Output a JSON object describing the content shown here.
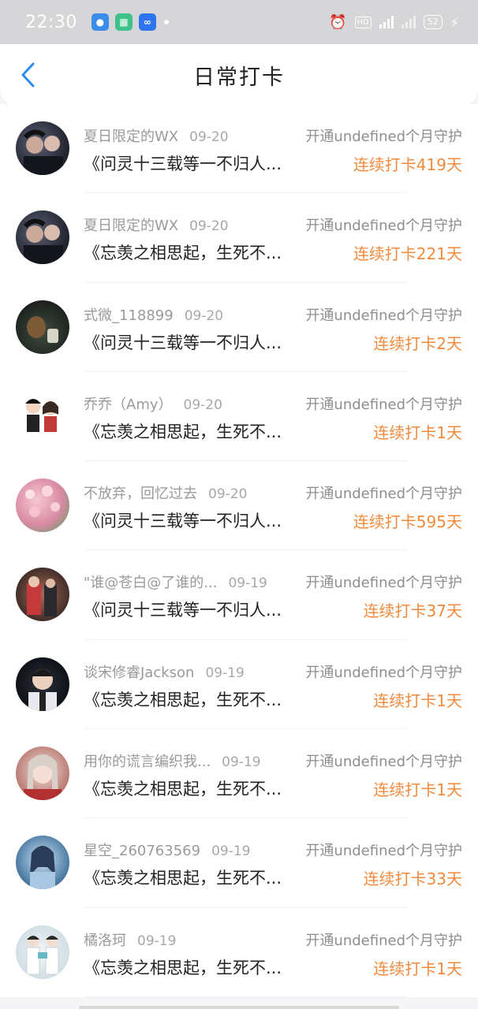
{
  "status_bar": {
    "time": "22:30",
    "battery": "52"
  },
  "header": {
    "title": "日常打卡"
  },
  "list": [
    {
      "name": "夏日限定的WX",
      "date": "09-20",
      "guard": "开通undefined个月守护",
      "content": "《问灵十三载等一不归人...",
      "streak": "连续打卡419天"
    },
    {
      "name": "夏日限定的WX",
      "date": "09-20",
      "guard": "开通undefined个月守护",
      "content": "《忘羡之相思起，生死不...",
      "streak": "连续打卡221天"
    },
    {
      "name": "式微_118899",
      "date": "09-20",
      "guard": "开通undefined个月守护",
      "content": "《问灵十三载等一不归人...",
      "streak": "连续打卡2天"
    },
    {
      "name": "乔乔（Amy）",
      "date": "09-20",
      "guard": "开通undefined个月守护",
      "content": "《忘羡之相思起，生死不...",
      "streak": "连续打卡1天"
    },
    {
      "name": "不放弃，回忆过去",
      "date": "09-20",
      "guard": "开通undefined个月守护",
      "content": "《问灵十三载等一不归人...",
      "streak": "连续打卡595天"
    },
    {
      "name": "\"谁@苍白@了谁的...",
      "date": "09-19",
      "guard": "开通undefined个月守护",
      "content": "《问灵十三载等一不归人...",
      "streak": "连续打卡37天"
    },
    {
      "name": "谈宋修睿Jackson",
      "date": "09-19",
      "guard": "开通undefined个月守护",
      "content": "《忘羡之相思起，生死不...",
      "streak": "连续打卡1天"
    },
    {
      "name": "用你的谎言编织我...",
      "date": "09-19",
      "guard": "开通undefined个月守护",
      "content": "《忘羡之相思起，生死不...",
      "streak": "连续打卡1天"
    },
    {
      "name": "星空_260763569",
      "date": "09-19",
      "guard": "开通undefined个月守护",
      "content": "《忘羡之相思起，生死不...",
      "streak": "连续打卡33天"
    },
    {
      "name": "橘洛珂",
      "date": "09-19",
      "guard": "开通undefined个月守护",
      "content": "《忘羡之相思起，生死不...",
      "streak": "连续打卡1天"
    }
  ],
  "colors": {
    "accent_blue": "#2a8cf0",
    "streak_orange": "#f28a3c"
  },
  "icons": {
    "back": "chevron-left-icon",
    "alarm": "alarm-icon",
    "signal": "signal-icon",
    "battery": "battery-icon"
  }
}
